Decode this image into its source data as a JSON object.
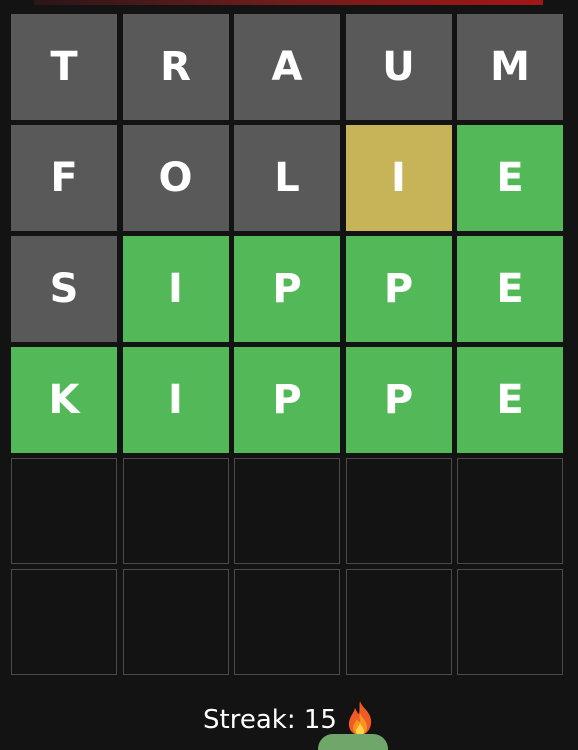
{
  "board": {
    "rows": [
      [
        {
          "letter": "T",
          "state": "absent"
        },
        {
          "letter": "R",
          "state": "absent"
        },
        {
          "letter": "A",
          "state": "absent"
        },
        {
          "letter": "U",
          "state": "absent"
        },
        {
          "letter": "M",
          "state": "absent"
        }
      ],
      [
        {
          "letter": "F",
          "state": "absent"
        },
        {
          "letter": "O",
          "state": "absent"
        },
        {
          "letter": "L",
          "state": "absent"
        },
        {
          "letter": "I",
          "state": "present"
        },
        {
          "letter": "E",
          "state": "correct"
        }
      ],
      [
        {
          "letter": "S",
          "state": "absent"
        },
        {
          "letter": "I",
          "state": "correct"
        },
        {
          "letter": "P",
          "state": "correct"
        },
        {
          "letter": "P",
          "state": "correct"
        },
        {
          "letter": "E",
          "state": "correct"
        }
      ],
      [
        {
          "letter": "K",
          "state": "correct"
        },
        {
          "letter": "I",
          "state": "correct"
        },
        {
          "letter": "P",
          "state": "correct"
        },
        {
          "letter": "P",
          "state": "correct"
        },
        {
          "letter": "E",
          "state": "correct"
        }
      ],
      [
        {
          "letter": "",
          "state": "empty"
        },
        {
          "letter": "",
          "state": "empty"
        },
        {
          "letter": "",
          "state": "empty"
        },
        {
          "letter": "",
          "state": "empty"
        },
        {
          "letter": "",
          "state": "empty"
        }
      ],
      [
        {
          "letter": "",
          "state": "empty"
        },
        {
          "letter": "",
          "state": "empty"
        },
        {
          "letter": "",
          "state": "empty"
        },
        {
          "letter": "",
          "state": "empty"
        },
        {
          "letter": "",
          "state": "empty"
        }
      ]
    ]
  },
  "streak": {
    "label": "Streak: 15",
    "icon": "fire-icon"
  },
  "colors": {
    "absent": "#595959",
    "present": "#c8b458",
    "correct": "#53b958",
    "background": "#131313",
    "empty_border": "#4a4a4a"
  }
}
